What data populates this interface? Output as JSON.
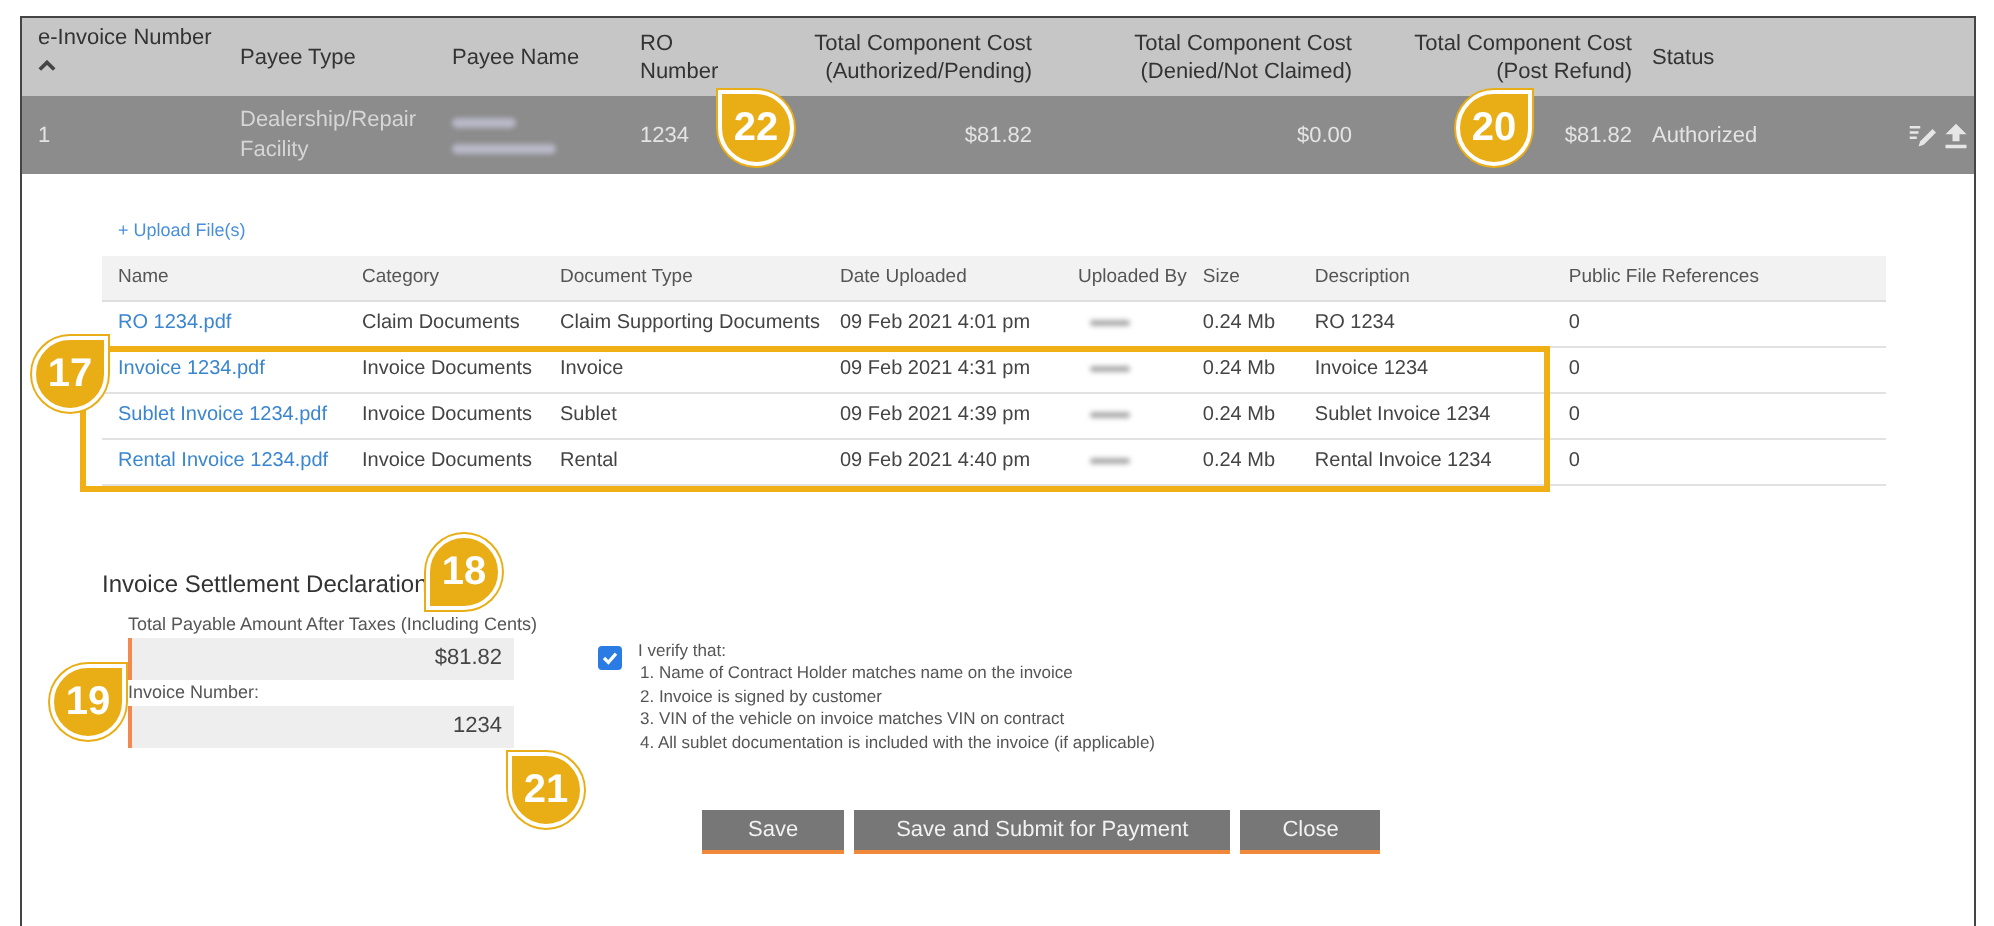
{
  "invoices": {
    "columns": [
      {
        "label": "e-Invoice Number",
        "sorted": true
      },
      {
        "label": "Payee Type",
        "sorted": false
      },
      {
        "label": "Payee Name",
        "sorted": false
      },
      {
        "label": "RO Number",
        "sorted": false
      },
      {
        "label": "Total Component Cost (Authorized/Pending)",
        "sorted": false
      },
      {
        "label": "Total Component Cost (Denied/Not Claimed)",
        "sorted": false
      },
      {
        "label": "Total Component Cost (Post Refund)",
        "sorted": false
      },
      {
        "label": "Status",
        "sorted": false
      }
    ],
    "rows": [
      {
        "e_invoice_number": "1",
        "payee_type": "Dealership/Repair Facility",
        "payee_name_redacted": true,
        "ro_number": "1234",
        "cost_authorized": "$81.82",
        "cost_denied": "$0.00",
        "cost_post_refund": "$81.82",
        "status": "Authorized"
      }
    ]
  },
  "files": {
    "upload_link": "+ Upload File(s)",
    "columns": [
      "Name",
      "Category",
      "Document Type",
      "Date Uploaded",
      "Uploaded By",
      "Size",
      "Description",
      "Public File References"
    ],
    "rows": [
      {
        "name": "RO 1234.pdf",
        "category": "Claim Documents",
        "document_type": "Claim Supporting Documents",
        "date_uploaded": "09 Feb 2021 4:01 pm",
        "uploaded_by_redacted": true,
        "size": "0.24 Mb",
        "description": "RO 1234",
        "public_file_references": "0",
        "highlighted": false
      },
      {
        "name": "Invoice 1234.pdf",
        "category": "Invoice Documents",
        "document_type": "Invoice",
        "date_uploaded": "09 Feb 2021 4:31 pm",
        "uploaded_by_redacted": true,
        "size": "0.24 Mb",
        "description": "Invoice 1234",
        "public_file_references": "0",
        "highlighted": true
      },
      {
        "name": "Sublet Invoice 1234.pdf",
        "category": "Invoice Documents",
        "document_type": "Sublet",
        "date_uploaded": "09 Feb 2021 4:39 pm",
        "uploaded_by_redacted": true,
        "size": "0.24 Mb",
        "description": "Sublet Invoice 1234",
        "public_file_references": "0",
        "highlighted": true
      },
      {
        "name": "Rental Invoice 1234.pdf",
        "category": "Invoice Documents",
        "document_type": "Rental",
        "date_uploaded": "09 Feb 2021 4:40 pm",
        "uploaded_by_redacted": true,
        "size": "0.24 Mb",
        "description": "Rental Invoice 1234",
        "public_file_references": "0",
        "highlighted": true
      }
    ]
  },
  "declaration": {
    "title": "Invoice Settlement Declaration",
    "fields": [
      {
        "label": "Total Payable Amount After Taxes (Including Cents)",
        "value": "$81.82"
      },
      {
        "label": "Invoice Number:",
        "value": "1234"
      }
    ],
    "verify": {
      "checked": true,
      "heading": "I verify that:",
      "items": [
        "1. Name of Contract Holder matches name on the invoice",
        "2. Invoice is signed by customer",
        "3. VIN of the vehicle on invoice matches VIN on contract",
        "4. All sublet documentation is included with the invoice (if applicable)"
      ]
    },
    "buttons": [
      "Save",
      "Save and Submit for Payment",
      "Close"
    ]
  },
  "callouts": [
    {
      "label": "22"
    },
    {
      "label": "20"
    },
    {
      "label": "17"
    },
    {
      "label": "18"
    },
    {
      "label": "19"
    },
    {
      "label": "21"
    }
  ]
}
